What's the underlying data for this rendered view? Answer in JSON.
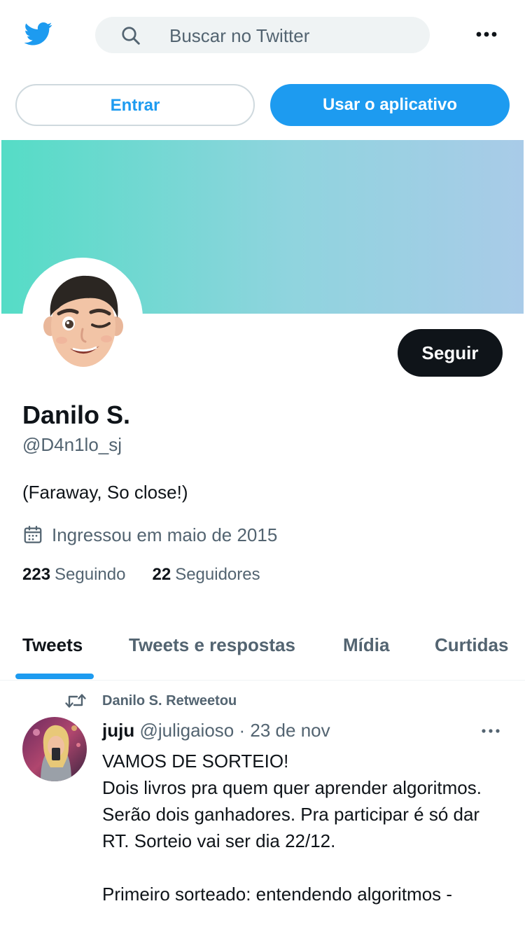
{
  "header": {
    "search_placeholder": "Buscar no Twitter",
    "icons": {
      "logo": "twitter-bird-icon",
      "search": "search-icon",
      "more": "more-horizontal-icon"
    }
  },
  "auth": {
    "login_label": "Entrar",
    "app_label": "Usar o aplicativo"
  },
  "profile": {
    "follow_label": "Seguir",
    "name": "Danilo S.",
    "handle": "@D4n1lo_sj",
    "bio": "(Faraway, So close!)",
    "joined": "Ingressou em maio de 2015",
    "following_count": "223",
    "following_label": "Seguindo",
    "followers_count": "22",
    "followers_label": "Seguidores"
  },
  "tabs": [
    {
      "label": "Tweets",
      "active": true
    },
    {
      "label": "Tweets e respostas",
      "active": false
    },
    {
      "label": "Mídia",
      "active": false
    },
    {
      "label": "Curtidas",
      "active": false
    }
  ],
  "tweet": {
    "retweet_label": "Danilo S. Retweetou",
    "author_name": "juju",
    "author_handle": "@juligaioso",
    "separator": "·",
    "date": "23 de nov",
    "text": "VAMOS DE SORTEIO!\nDois livros pra quem quer aprender algoritmos. Serão dois ganhadores. Pra participar é só dar RT. Sorteio vai ser dia 22/12.\n\nPrimeiro sorteado: entendendo algoritmos -"
  },
  "colors": {
    "accent": "#1d9bf0",
    "text": "#0f1419",
    "muted": "#536471",
    "banner_start": "#55dcc6",
    "banner_end": "#a9cbe8"
  }
}
